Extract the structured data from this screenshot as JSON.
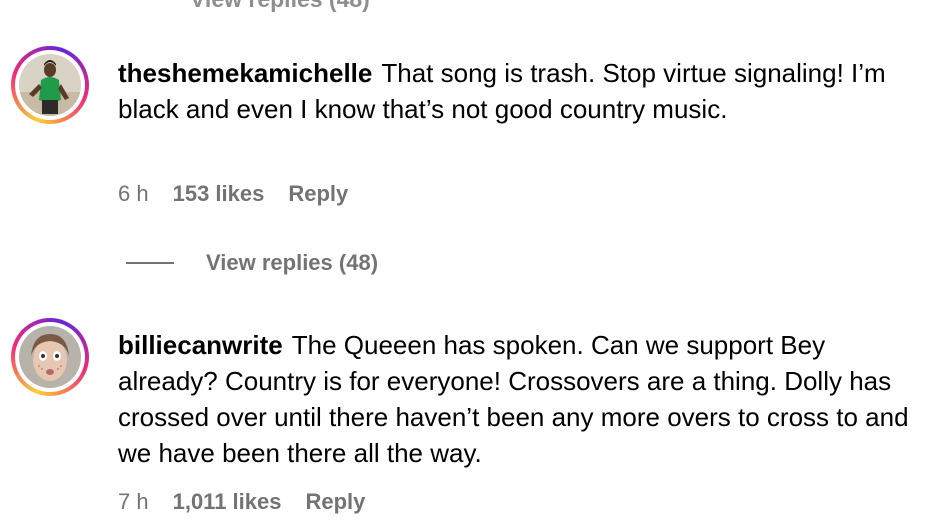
{
  "top_cut_text": "View replies (48)",
  "comments": [
    {
      "username": "theshemekamichelle",
      "text": "That song is trash. Stop virtue signaling! I’m black and even I know that’s not good country music.",
      "time": "6 h",
      "likes": "153 likes",
      "reply_label": "Reply",
      "view_replies": "View replies (48)"
    },
    {
      "username": "billiecanwrite",
      "text": "The Queeen has spoken. Can we support Bey already? Country is for everyone! Crossovers are a thing. Dolly has crossed over until there haven’t been any more overs to cross to and we have been there all the way.",
      "time": "7 h",
      "likes": "1,011 likes",
      "reply_label": "Reply"
    }
  ]
}
